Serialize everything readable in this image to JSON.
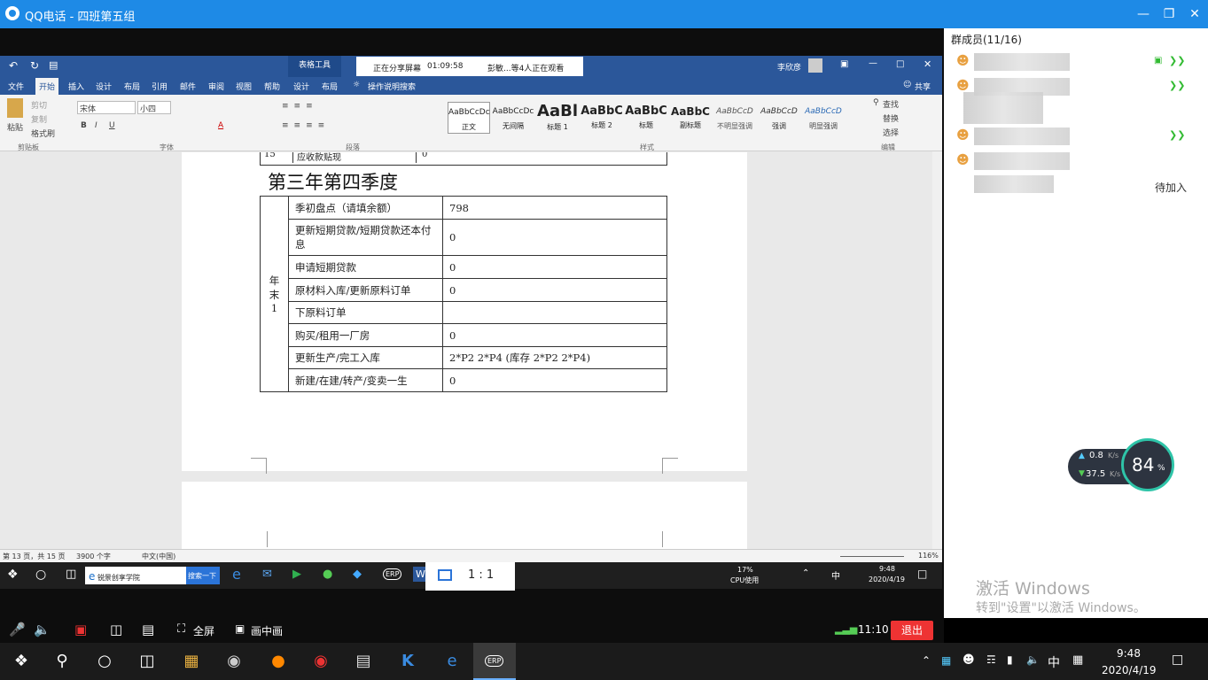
{
  "app": {
    "title": "QQ电话 - 四班第五组"
  },
  "word": {
    "tabtool": "表格工具",
    "share_status": "正在分享屏幕",
    "share_time": "01:09:58",
    "share_viewers": "彭敏...等4人正在观看",
    "user": "李欣彦",
    "menu": [
      "文件",
      "开始",
      "插入",
      "设计",
      "布局",
      "引用",
      "邮件",
      "审阅",
      "视图",
      "帮助",
      "设计",
      "布局"
    ],
    "search": "操作说明搜索",
    "share_btn": "共享",
    "font_name": "宋体",
    "font_size": "小四",
    "clipboard": {
      "paste": "粘贴",
      "cut": "剪切",
      "copy": "复制",
      "format": "格式刷",
      "label": "剪贴板"
    },
    "groups": {
      "font": "字体",
      "paragraph": "段落",
      "styles": "样式",
      "edit": "编辑"
    },
    "styles": [
      {
        "sample": "AaBbCcDc",
        "name": "正文"
      },
      {
        "sample": "AaBbCcDc",
        "name": "无间隔"
      },
      {
        "sample": "AaBl",
        "name": "标题 1"
      },
      {
        "sample": "AaBbC",
        "name": "标题 2"
      },
      {
        "sample": "AaBbC",
        "name": "标题"
      },
      {
        "sample": "AaBbC",
        "name": "副标题"
      },
      {
        "sample": "AaBbCcD",
        "name": "不明显强调"
      },
      {
        "sample": "AaBbCcD",
        "name": "强调"
      },
      {
        "sample": "AaBbCcD",
        "name": "明显强调"
      }
    ],
    "edit": {
      "find": "查找",
      "replace": "替换",
      "select": "选择"
    },
    "prev_row": {
      "num": "15",
      "label": "应收款贴现",
      "value": "0"
    },
    "heading": "第三年第四季度",
    "row_header": "年末1",
    "rows": [
      {
        "label": "季初盘点（请填余额）",
        "value": "798"
      },
      {
        "label": "更新短期贷款/短期贷款还本付息",
        "value": "0"
      },
      {
        "label": "申请短期贷款",
        "value": "0"
      },
      {
        "label": "原材料入库/更新原料订单",
        "value": "0"
      },
      {
        "label": "下原料订单",
        "value": ""
      },
      {
        "label": "购买/租用一厂房",
        "value": "0"
      },
      {
        "label": "更新生产/完工入库",
        "value": "2*P2   2*P4    (库存 2*P2   2*P4)"
      },
      {
        "label": "新建/在建/转产/变卖一生",
        "value": "0"
      }
    ],
    "status": {
      "page": "第 13 页，共 15 页",
      "words": "3900 个字",
      "lang": "中文(中国)",
      "zoom": "116%"
    }
  },
  "remote_taskbar": {
    "search_text": "锐景创享学院",
    "search_btn": "搜索一下",
    "cpu": "17%",
    "cpu_label": "CPU使用",
    "time": "9:48",
    "date": "2020/4/19",
    "ime": "中",
    "ratio": "1 : 1"
  },
  "controls": {
    "fullscreen": "全屏",
    "pip": "画中画",
    "time": "11:10",
    "exit": "退出"
  },
  "side": {
    "header": "群成员(11/16)",
    "pending": "待加入",
    "speed_up": "0.8",
    "speed_down": "37.5",
    "speed_unit": "K/s",
    "usage": "84",
    "activate": "激活 Windows",
    "activate_sub": "转到\"设置\"以激活 Windows。"
  },
  "taskbar": {
    "time": "9:48",
    "date": "2020/4/19",
    "ime": "中"
  }
}
